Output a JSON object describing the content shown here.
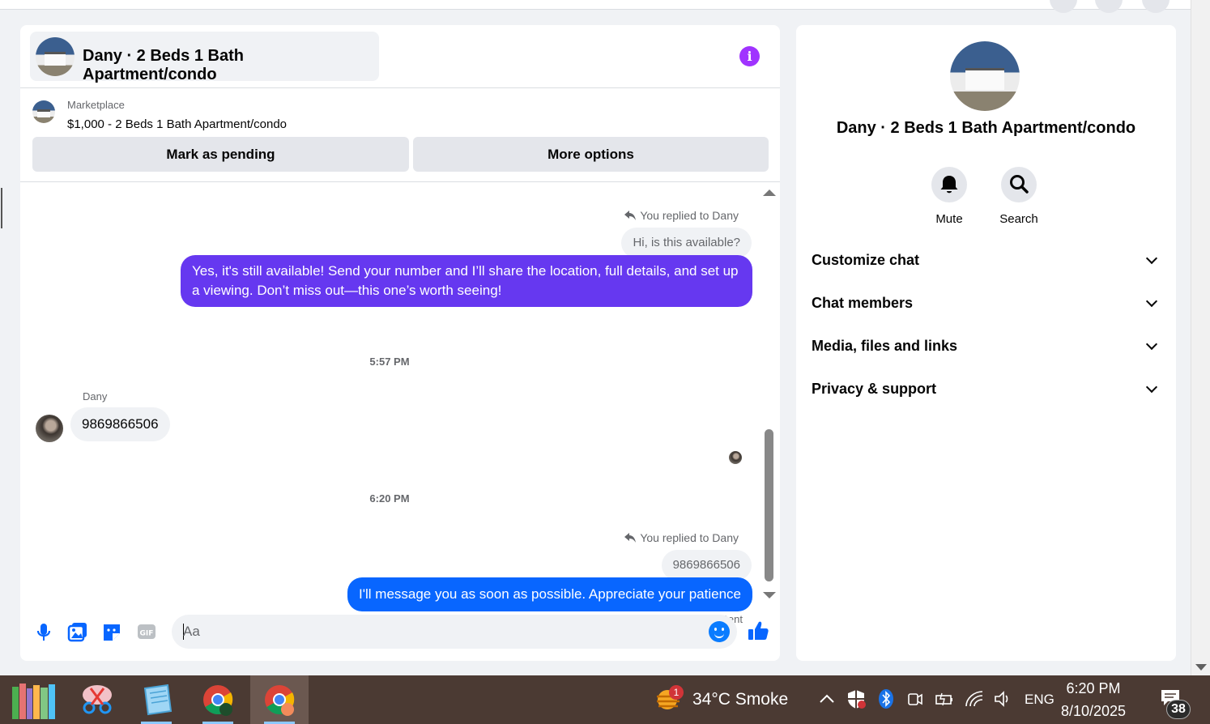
{
  "conversation": {
    "title": "Dany · 2 Beds 1 Bath Apartment/condo",
    "info_icon": "info-icon"
  },
  "listing": {
    "category": "Marketplace",
    "title": "$1,000 - 2 Beds 1 Bath Apartment/condo",
    "mark_pending_label": "Mark as pending",
    "more_options_label": "More options"
  },
  "messages": {
    "reply1_label": "You replied to Dany",
    "reply1_quote": "Hi, is this available?",
    "msg1_text": "Yes, it's still available! Send your number and I’ll share the location, full details, and set up a viewing. Don’t miss out—this one’s worth seeing!",
    "time1": "5:57 PM",
    "sender_name": "Dany",
    "incoming_text": "9869866506",
    "time2": "6:20 PM",
    "reply2_label": "You replied to Dany",
    "reply2_quote": "9869866506",
    "msg2_text": "I'll message you as soon as possible. Appreciate your patience",
    "status": "Sent"
  },
  "composer": {
    "placeholder": "Aa"
  },
  "sidebar": {
    "title": "Dany · 2 Beds 1 Bath Apartment/condo",
    "mute_label": "Mute",
    "search_label": "Search",
    "sections": [
      {
        "label": "Customize chat"
      },
      {
        "label": "Chat members"
      },
      {
        "label": "Media, files and links"
      },
      {
        "label": "Privacy & support"
      }
    ]
  },
  "taskbar": {
    "weather_temp": "34°C",
    "weather_desc": "Smoke",
    "weather_badge": "1",
    "language": "ENG",
    "time": "6:20 PM",
    "date": "8/10/2025",
    "notification_count": "38"
  },
  "colors": {
    "accent_purple": "#6638f0",
    "accent_blue": "#0a7cff",
    "messenger_blue": "#0866ff",
    "info_purple": "#a033ff",
    "taskbar_bg": "#4b3a33"
  }
}
